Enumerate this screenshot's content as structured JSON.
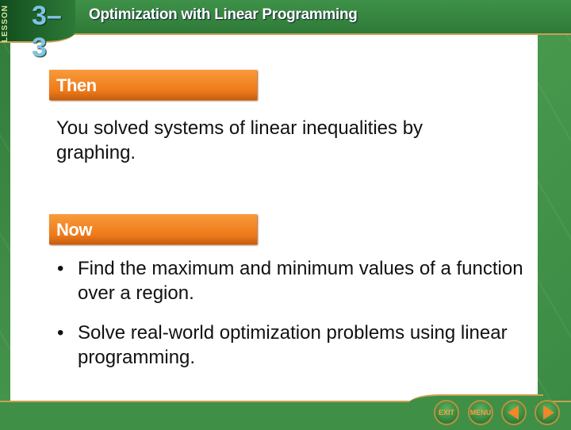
{
  "header": {
    "lesson_label": "LESSON",
    "lesson_number": "3–3",
    "title": "Optimization with Linear Programming"
  },
  "then": {
    "label": "Then",
    "text": "You solved systems of linear inequalities by graphing."
  },
  "now": {
    "label": "Now",
    "bullets": [
      "Find the maximum and minimum values of a function over a region.",
      "Solve real-world optimization problems using linear programming."
    ]
  },
  "nav": {
    "exit": "EXIT",
    "menu": "MENU",
    "prev_icon": "triangle-left-icon",
    "next_icon": "triangle-right-icon"
  },
  "colors": {
    "accent": "#ee7a1a",
    "frame": "#3f8f47",
    "trim": "#c9a050"
  }
}
